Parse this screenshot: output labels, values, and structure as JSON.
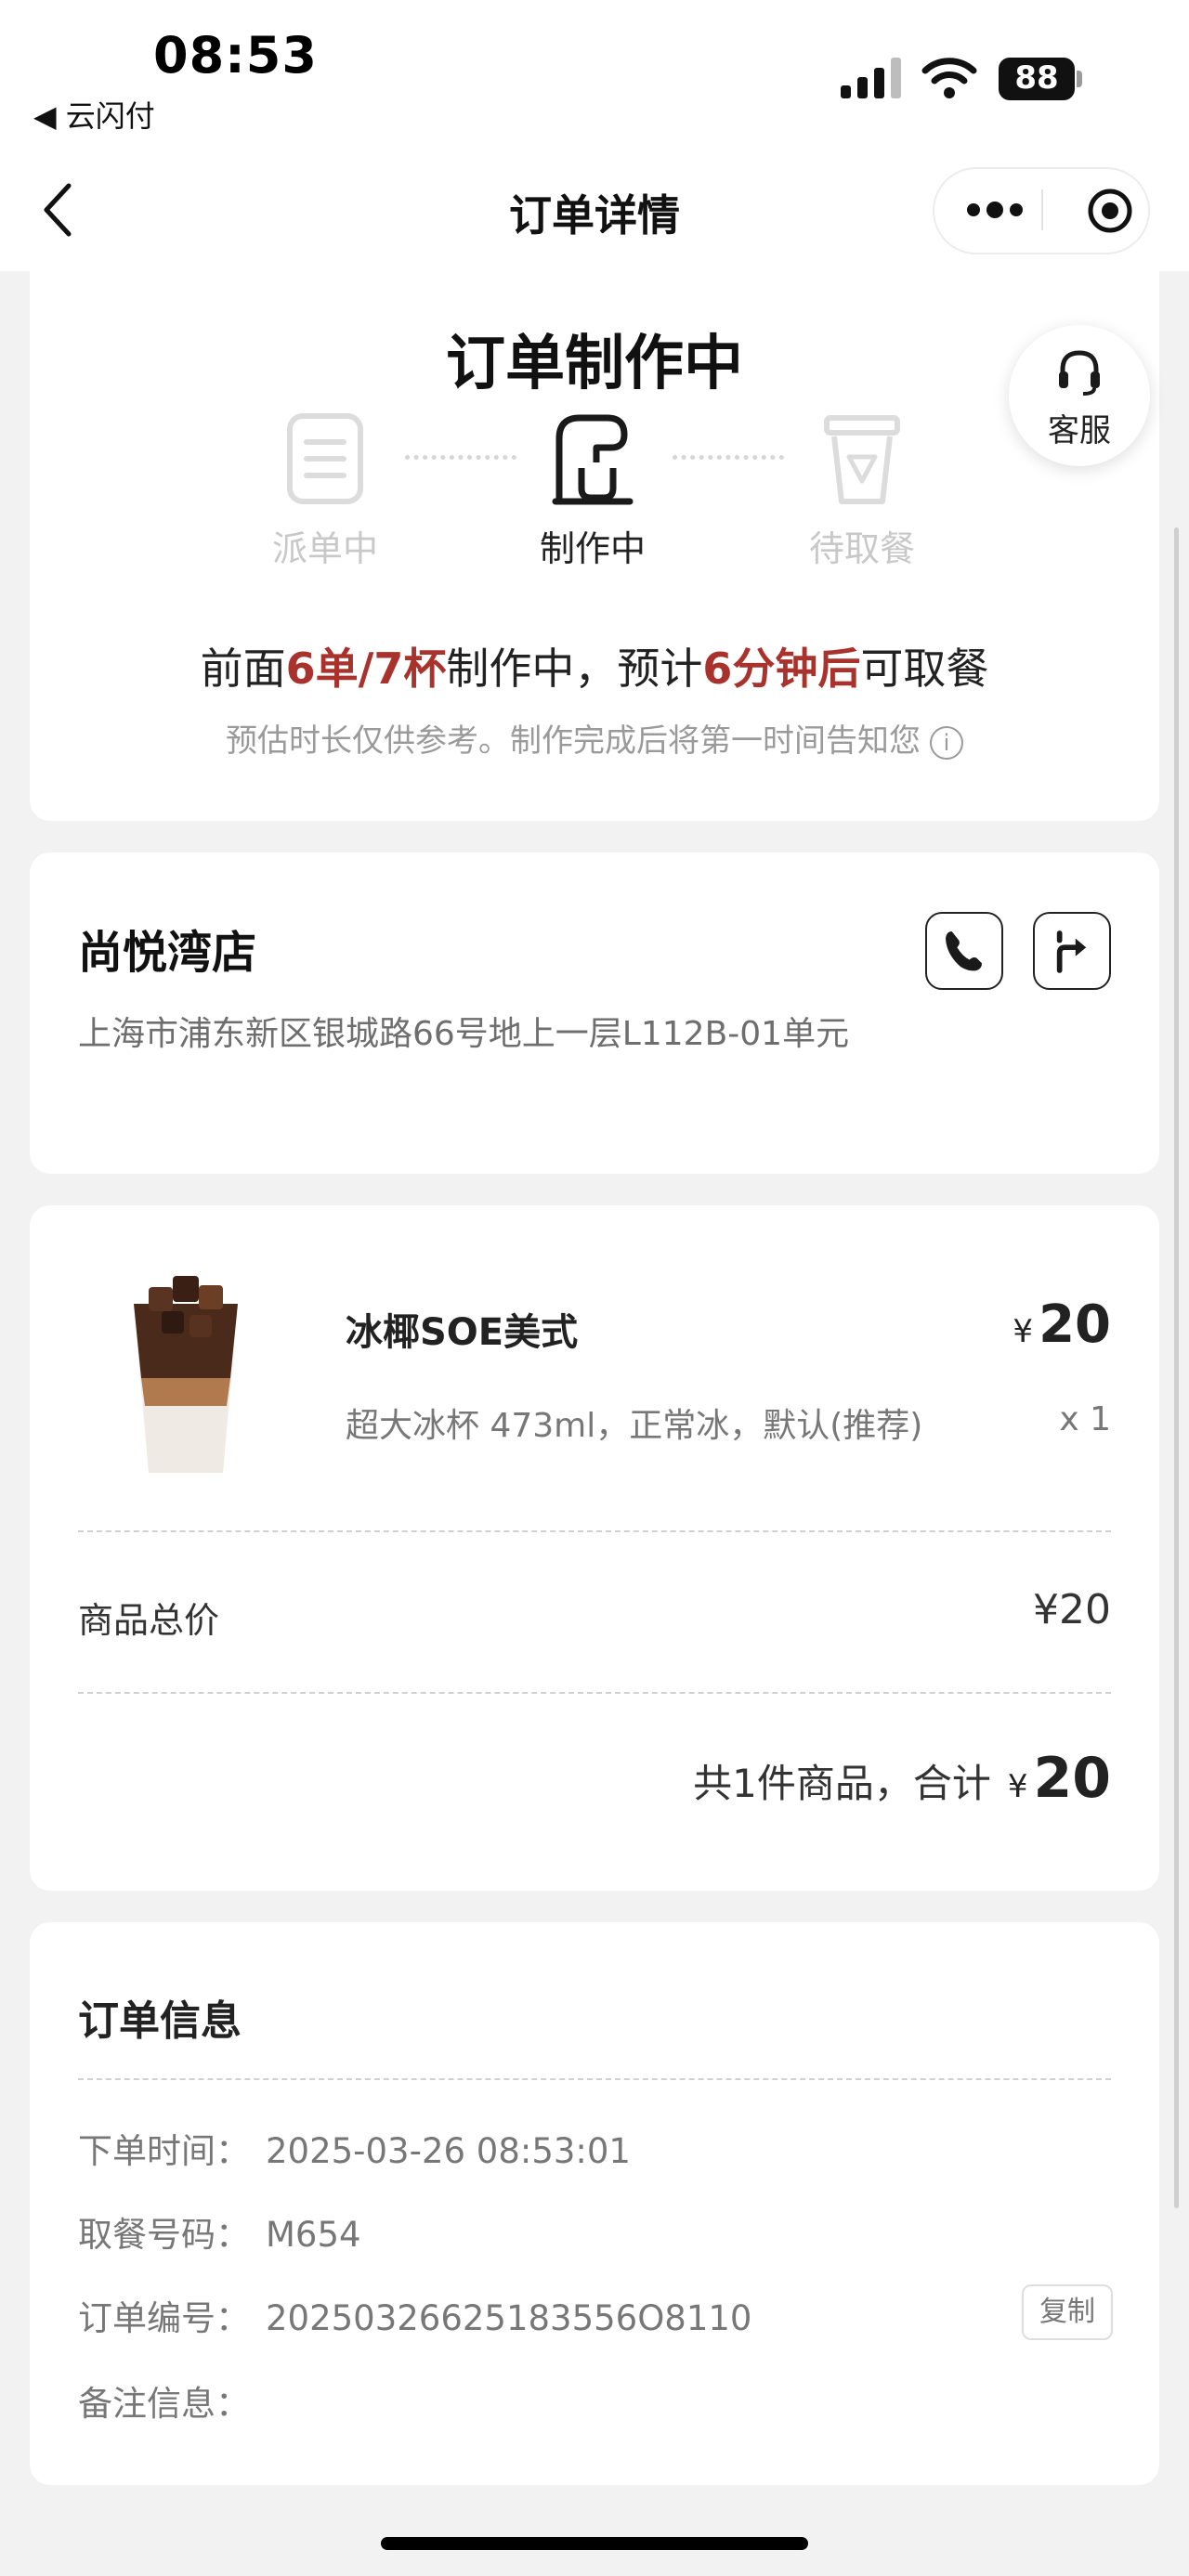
{
  "status_bar": {
    "time": "08:53",
    "back_app": "◀ 云闪付",
    "battery": "88"
  },
  "nav": {
    "title": "订单详情"
  },
  "order_status": {
    "title": "订单制作中",
    "steps": [
      {
        "label": "派单中",
        "state": "done",
        "icon": "list-icon"
      },
      {
        "label": "制作中",
        "state": "active",
        "icon": "coffee-machine-icon"
      },
      {
        "label": "待取餐",
        "state": "pending",
        "icon": "cup-icon"
      }
    ],
    "queue": {
      "prefix": "前面",
      "orders_cups": "6单/7杯",
      "middle": "制作中，预计",
      "minutes": "6分钟后",
      "suffix": "可取餐"
    },
    "note": "预估时长仅供参考。制作完成后将第一时间告知您",
    "note_icon": "i"
  },
  "customer_service": {
    "label": "客服"
  },
  "store": {
    "name": "尚悦湾店",
    "address": "上海市浦东新区银城路66号地上一层L112B-01单元"
  },
  "product": {
    "name": "冰椰SOE美式",
    "spec": "超大冰杯 473ml，正常冰，默认(推荐)",
    "currency": "¥",
    "price": "20",
    "qty": "x 1"
  },
  "summary": {
    "subtotal_label": "商品总价",
    "subtotal_value": "¥20",
    "total_label": "共1件商品，合计",
    "total_currency": "¥",
    "total_value": "20"
  },
  "order_info": {
    "title": "订单信息",
    "rows": [
      {
        "key": "下单时间：",
        "value": "2025-03-26 08:53:01"
      },
      {
        "key": "取餐号码：",
        "value": "M654"
      },
      {
        "key": "订单编号：",
        "value": "20250326625183556O8110"
      },
      {
        "key": "备注信息：",
        "value": ""
      }
    ],
    "copy_label": "复制"
  },
  "colors": {
    "highlight": "#a9322c",
    "page_bg": "#f2f2f2",
    "card_bg": "#ffffff"
  }
}
